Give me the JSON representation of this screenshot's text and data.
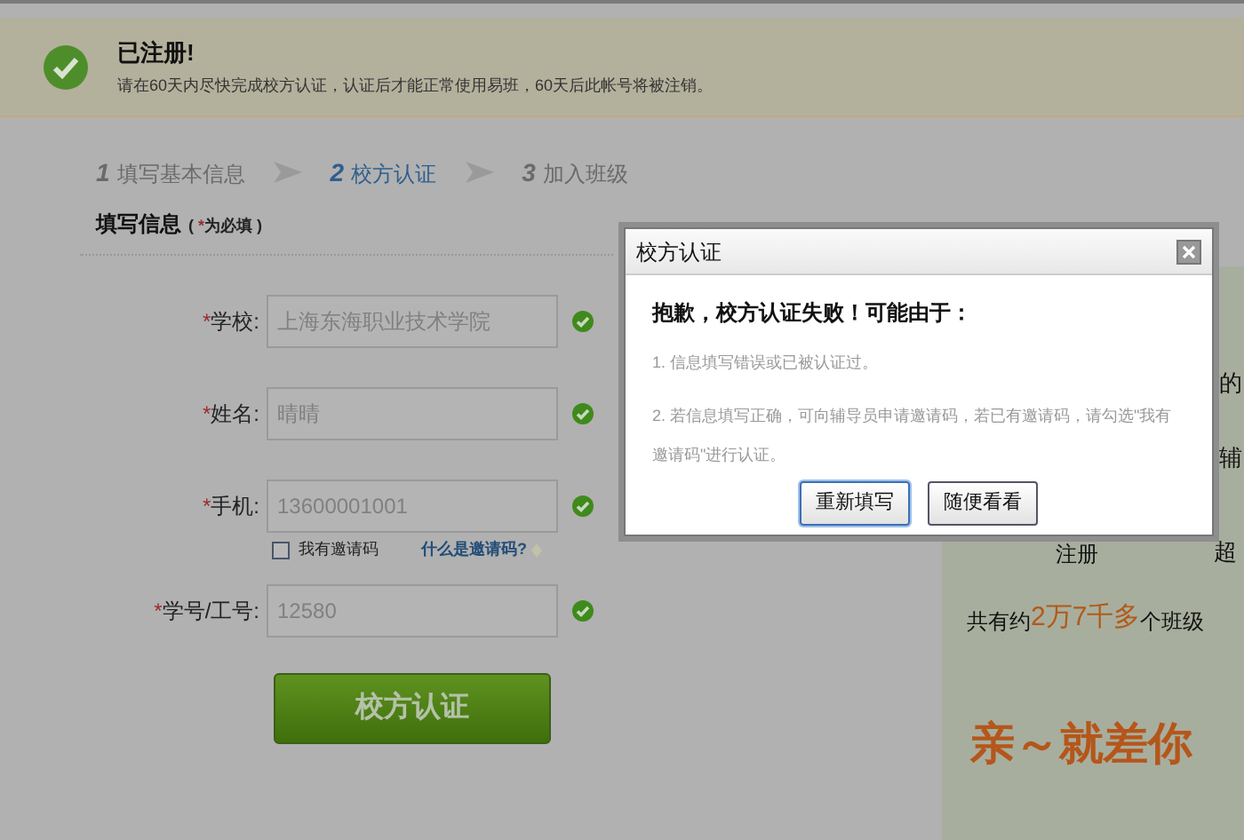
{
  "notice": {
    "title": "已注册!",
    "message": "请在60天内尽快完成校方认证，认证后才能正常使用易班，60天后此帐号将被注销。"
  },
  "steps": [
    {
      "number": "1",
      "label": "填写基本信息",
      "selected": false
    },
    {
      "number": "2",
      "label": "校方认证",
      "selected": true
    },
    {
      "number": "3",
      "label": "加入班级",
      "selected": false
    }
  ],
  "form": {
    "title": "填写信息",
    "required_note_open": "(",
    "required_note_mark": "*",
    "required_note": "为必填",
    "required_note_close": ")",
    "fields": [
      {
        "label": "学校:",
        "value": "上海东海职业技术学院",
        "valid": true
      },
      {
        "label": "姓名:",
        "value": "晴晴",
        "valid": true
      },
      {
        "label": "手机:",
        "value": "13600001001",
        "valid": true
      },
      {
        "label": "学号/工号:",
        "value": "12580",
        "valid": true
      }
    ],
    "invite": {
      "label": "我有邀请码",
      "checked": false,
      "link": "什么是邀请码?"
    },
    "submit": "校方认证"
  },
  "promo": {
    "lines": [
      {
        "text": "的"
      },
      {
        "text": "辅"
      },
      {
        "text": "注册",
        "after": "超"
      },
      {
        "text": "共有约",
        "highlight": "2万7千多",
        "after": "个班级"
      }
    ],
    "slogan": "亲～就差你"
  },
  "dialog": {
    "title": "校方认证",
    "heading": "抱歉，校方认证失败！可能由于：",
    "reasons": [
      "1. 信息填写错误或已被认证过。",
      "2. 若信息填写正确，可向辅导员申请邀请码，若已有邀请码，请勾选\"我有邀请码\"进行认证。"
    ],
    "buttons": [
      {
        "label": "重新填写",
        "selected": true
      },
      {
        "label": "随便看看",
        "selected": false
      }
    ]
  }
}
